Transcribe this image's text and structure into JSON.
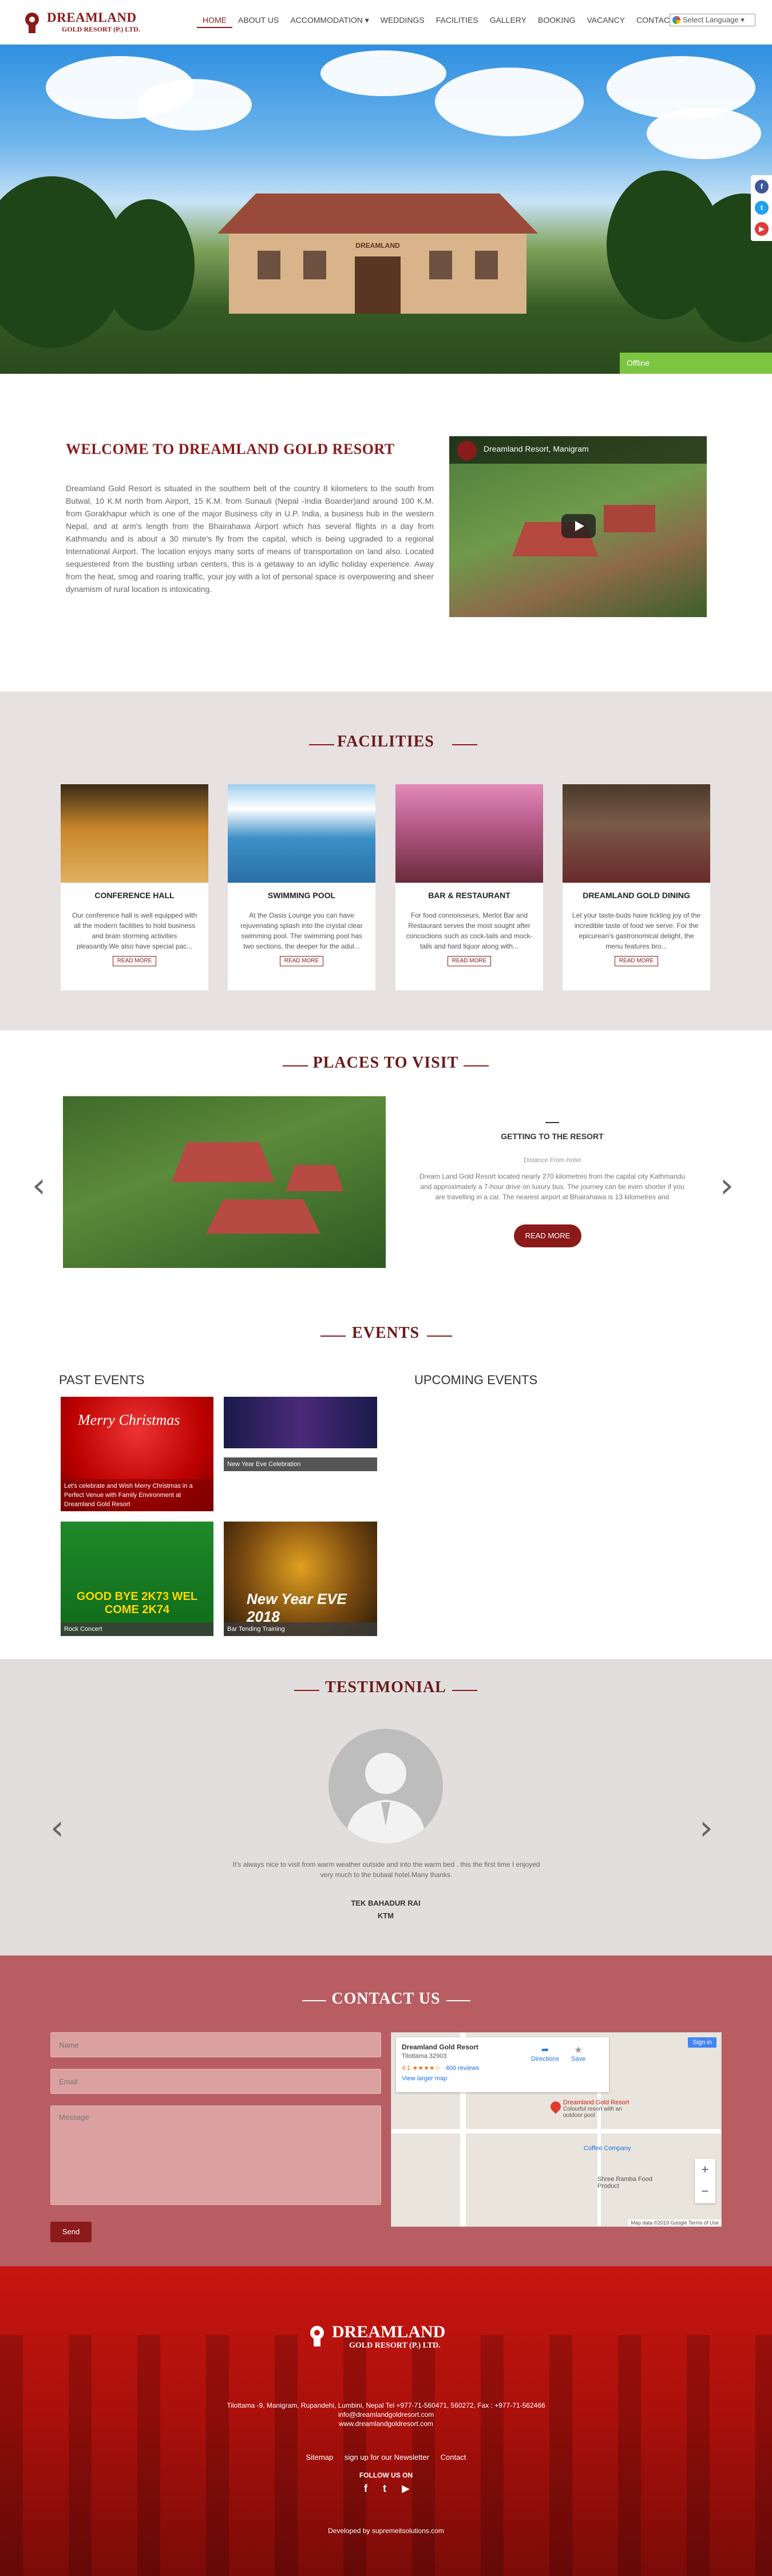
{
  "nav": {
    "logo_line1": "DREAMLAND",
    "logo_line2": "GOLD RESORT (P.) LTD.",
    "items": [
      "HOME",
      "ABOUT US",
      "ACCOMMODATION ▾",
      "WEDDINGS",
      "FACILITIES",
      "GALLERY",
      "BOOKING",
      "VACANCY",
      "CONTACT"
    ],
    "language": "Select Language ▾"
  },
  "hero": {
    "offline_label": "Offline",
    "sign_text": "DREAMLAND"
  },
  "welcome": {
    "title": "WELCOME TO DREAMLAND GOLD RESORT",
    "text": "Dreamland Gold Resort is situated in the southern belt of the country 8 kilometers to the south from Butwal, 10 K.M north from Airport, 15 K.M. from Sunauli (Nepal -India Boarder)and around 100 K.M. from Gorakhapur which is one of the major Business city in U.P. India, a business hub in the western Nepal, and at arm's length from the Bhairahawa Airport which has several flights in a day from Kathmandu and is about a 30 minute's fly from the capital, which is being upgraded to a regional International Airport. The location enjoys many sorts of means of transportation on land also. Located sequestered from the bustling urban centers, this is a getaway to an idyllic holiday experience. Away from the heat, smog and roaring traffic, your joy with a lot of personal space is overpowering and sheer dynamism of rural location is intoxicating.",
    "video_title": "Dreamland Resort, Manigram"
  },
  "facilities": {
    "title": "FACILITIES",
    "cards": [
      {
        "title": "CONFERENCE HALL",
        "desc": "Our conference hall is well equipped with all the modern facilities to hold business and brain storming activities pleasantly.We also have special pac...",
        "button": "READ MORE",
        "color": "#c8872a"
      },
      {
        "title": "SWIMMING POOL",
        "desc": "At the Oasis Lounge you can have rejuvenating splash into the crystal clear swimming pool. The swimming pool has two sections, the deeper for the adul...",
        "button": "READ MORE",
        "color": "#3b8fc7"
      },
      {
        "title": "BAR & RESTAURANT",
        "desc": "For food connoisseurs, Merlot Bar and Restaurant serves the most sought after concoctions such as cock-tails and mock-tails and hard liquor along with...",
        "button": "READ MORE",
        "color": "#b85c8a"
      },
      {
        "title": "DREAMLAND GOLD DINING",
        "desc": "Let your taste-buds have tickling joy of the incredible taste of food we serve. For the epicurean's gastronomical delight, the menu features bro...",
        "button": "READ MORE",
        "color": "#6a3a3a"
      }
    ]
  },
  "places": {
    "title": "PLACES TO VISIT",
    "slide_title": "GETTING TO THE RESORT",
    "slide_small": "Distance From Hotel",
    "slide_text": "Dream Land Gold Resort located nearly 270 kilometres from the capital city Kathmandu and approximately a 7-hour drive on luxury bus. The journey can be even shorter if you are travelling in a car. The nearest airport at Bhairahawa is 13 kilometres and",
    "button": "READ MORE",
    "prev": "‹",
    "next": "›"
  },
  "events": {
    "title": "EVENTS",
    "past_label": "PAST EVENTS",
    "upcoming_label": "UPCOMING EVENTS",
    "items": [
      {
        "caption": "Let's celebrate and Wish Merry Christmas in a Perfect Venue with Family Environment at Dreamland Gold Resort",
        "art": "Merry Christmas"
      },
      {
        "caption": "New Year Eve Celebration",
        "art": ""
      },
      {
        "caption": "Rock Concert",
        "art": "GOOD BYE 2K73  WEL COME 2K74"
      },
      {
        "caption": "Bar Tending Training",
        "art": "New Year EVE 2018"
      }
    ]
  },
  "testimonial": {
    "title": "TESTIMONIAL",
    "text": "It's always nice to visit from warm weather outside and into the warm bed . this the first time I enjoyed very much to the butwal hotel.Many thanks.",
    "name": "TEK BAHADUR RAI",
    "location": "KTM",
    "prev": "‹",
    "next": "›"
  },
  "contact": {
    "title": "CONTACT US",
    "name_placeholder": "Name",
    "email_placeholder": "Email",
    "message_placeholder": "Message",
    "send": "Send",
    "map": {
      "place": "Dreamland Gold Resort",
      "address": "Tilottama 32903",
      "rating": "4.1 ★★★★☆",
      "reviews": "400 reviews",
      "larger": "View larger map",
      "directions": "Directions",
      "save": "Save",
      "signin": "Sign in",
      "pin_label": "Dreamland Gold Resort",
      "pin_sub": "Colourful resort with an outdoor pool",
      "coffee": "Coffee Company",
      "food": "Shree Ramba Food Product",
      "attribution": "Map data ©2019 Google   Terms of Use",
      "zoom_in": "+",
      "zoom_out": "−"
    }
  },
  "footer": {
    "logo_line1": "DREAMLAND",
    "logo_line2": "GOLD RESORT (P.) LTD.",
    "address": "Tilottama -9, Manigram, Rupandehi, Lumbini, Nepal Tel +977-71-560471, 560272, Fax : +977-71-562466",
    "email": "info@dreamlandgoldresort.com",
    "website": "www.dreamlandgoldresort.com",
    "links": [
      "Sitemap",
      "sign up for our Newsletter",
      "Contact"
    ],
    "follow": "FOLLOW US ON",
    "developed": "Developed by supremeitsolutions.com"
  },
  "colors": {
    "brand": "#8b1a1a",
    "facility_bg": "#e7e1e1",
    "contact_bg": "#b85d62",
    "footer_bg": "#c8150f"
  }
}
